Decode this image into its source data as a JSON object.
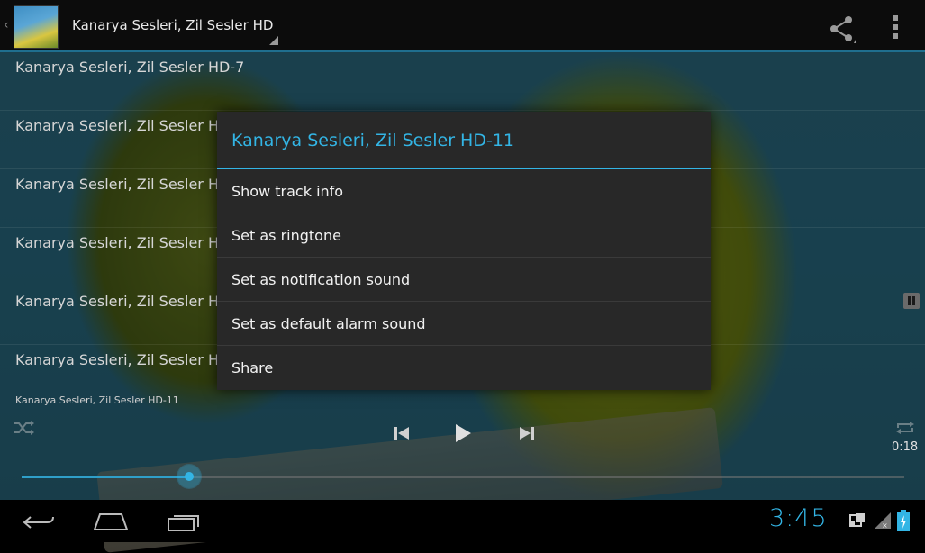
{
  "action_bar": {
    "title": "Kanarya Sesleri, Zil Sesler HD",
    "icons": [
      "app-icon",
      "share-icon",
      "overflow-menu-icon"
    ]
  },
  "track_list": [
    "Kanarya Sesleri, Zil Sesler HD-7",
    "Kanarya Sesleri, Zil Sesler H",
    "Kanarya Sesleri, Zil Sesler H",
    "Kanarya Sesleri, Zil Sesler H",
    "Kanarya Sesleri, Zil Sesler H",
    "Kanarya Sesleri, Zil Sesler H"
  ],
  "player": {
    "now_playing": "Kanarya Sesleri, Zil Sesler HD-11",
    "elapsed": "0:18",
    "progress": 0.19
  },
  "dialog": {
    "title": "Kanarya Sesleri, Zil Sesler HD-11",
    "items": [
      "Show track info",
      "Set as ringtone",
      "Set as notification sound",
      "Set as default alarm sound",
      "Share"
    ]
  },
  "system_bar": {
    "clock": "3:45"
  },
  "colors": {
    "accent": "#33b5e5",
    "dialog_bg": "#282828",
    "action_bar_bg": "#0c0c0c"
  }
}
